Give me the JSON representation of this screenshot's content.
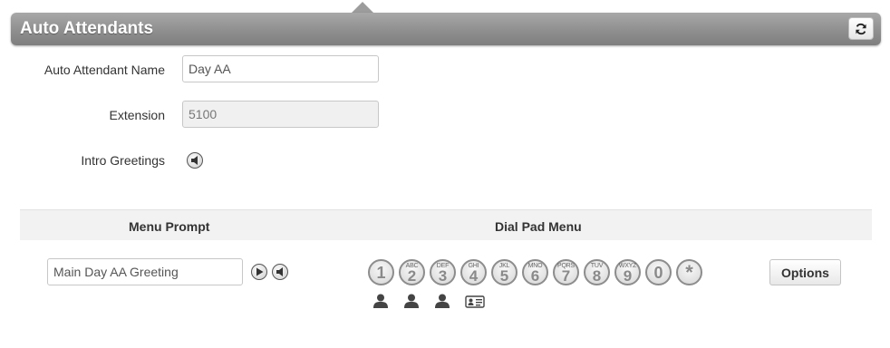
{
  "header": {
    "title": "Auto Attendants"
  },
  "form": {
    "name_label": "Auto Attendant Name",
    "name_value": "Day AA",
    "extension_label": "Extension",
    "extension_value": "5100",
    "greetings_label": "Intro Greetings"
  },
  "menu": {
    "prompt_header": "Menu Prompt",
    "dialpad_header": "Dial Pad Menu",
    "prompt_value": "Main Day AA Greeting",
    "options_label": "Options",
    "keys": [
      {
        "digit": "1",
        "letters": ""
      },
      {
        "digit": "2",
        "letters": "ABC"
      },
      {
        "digit": "3",
        "letters": "DEF"
      },
      {
        "digit": "4",
        "letters": "GHI"
      },
      {
        "digit": "5",
        "letters": "JKL"
      },
      {
        "digit": "6",
        "letters": "MNO"
      },
      {
        "digit": "7",
        "letters": "PQRS"
      },
      {
        "digit": "8",
        "letters": "TUV"
      },
      {
        "digit": "9",
        "letters": "WXYZ"
      },
      {
        "digit": "0",
        "letters": ""
      },
      {
        "digit": "*",
        "letters": ""
      }
    ],
    "key_assignments": [
      "user-icon",
      "user-icon",
      "user-icon",
      "contact-card-icon"
    ]
  }
}
